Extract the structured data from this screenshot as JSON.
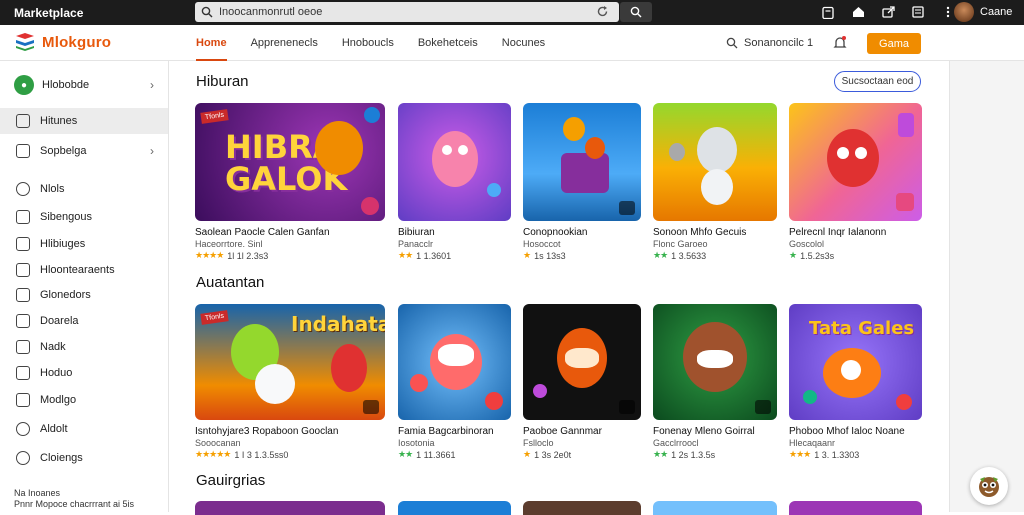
{
  "topbar": {
    "app_title": "Marketplace",
    "search_value": "Inoocanmonrutl oeoe",
    "user_name": "Caane"
  },
  "navbar": {
    "logo_text": "Mlokguro",
    "tabs": [
      "Home",
      "Apprenenecls",
      "Hnoboucls",
      "Bokehetceis",
      "Nocunes"
    ],
    "account_text": "Sonanoncilc 1",
    "cta_label": "Gama"
  },
  "sidebar": {
    "profile_label": "Hlobobde",
    "items": [
      "Hitunes",
      "Sopbelga",
      "Nlols",
      "Sibengous",
      "Hlibiuges",
      "Hloontearaents",
      "Glonedors",
      "Doarela",
      "Nadk",
      "Hoduo",
      "Modlgo",
      "Aldolt",
      "Cloiengs"
    ],
    "footer_line1": "Na   Inoanes",
    "footer_line2": "Pnnr  Mopoce chacrrrant ai 5is"
  },
  "sections": [
    {
      "title": "Hiburan",
      "see_all": "Sucsoctaan eod",
      "cards": [
        {
          "name": "Saolean Paocle Calen Ganfan",
          "dev": "Haceorrtore. Sinl",
          "rating": "1l 1l 2.3s3",
          "stars": "★★★★",
          "art": "HIBRA GALOK",
          "badge": "Tfonls"
        },
        {
          "name": "Bibiuran",
          "dev": "Panacclr",
          "rating": "1 1.3601",
          "stars": "★★",
          "art": "",
          "badge": ""
        },
        {
          "name": "Conopnookian",
          "dev": "Hosoccot",
          "rating": "1s 13s3",
          "stars": "★",
          "art": "",
          "badge": ""
        },
        {
          "name": "Sonoon Mhfo Gecuis",
          "dev": "Flonc Garoeo",
          "rating": "1 3.5633",
          "stars": "★★",
          "art": "",
          "badge": ""
        },
        {
          "name": "Pelrecnl Inqr Ialanonn",
          "dev": "Goscolol",
          "rating": "1.5.2s3s",
          "stars": "★",
          "art": "",
          "badge": ""
        }
      ]
    },
    {
      "title": "Auatantan",
      "see_all": "",
      "cards": [
        {
          "name": "Isntohyjare3 Ropaboon Gooclan",
          "dev": "Sooocanan",
          "rating": "1 I 3 1.3.5ss0",
          "stars": "★★★★★",
          "art": "Indahatan",
          "badge": "Tfonls"
        },
        {
          "name": "Famia Bagcarbinoran",
          "dev": "Iosotonia",
          "rating": "1 11.3661",
          "stars": "★★",
          "art": "",
          "badge": ""
        },
        {
          "name": "Paoboe Gannmar",
          "dev": "Fslloclo",
          "rating": "1 3s 2e0t",
          "stars": "★",
          "art": "",
          "badge": ""
        },
        {
          "name": "Fonenay Mleno Goirral",
          "dev": "Gacclrroocl",
          "rating": "1 2s 1.3.5s",
          "stars": "★★",
          "art": "",
          "badge": ""
        },
        {
          "name": "Phoboo Mhof Ialoc Noane",
          "dev": "Hlecaqaanr",
          "rating": "1 3. 1.3303",
          "stars": "★★★",
          "art": "Tata Gales",
          "badge": ""
        }
      ]
    },
    {
      "title": "Gauirgrias",
      "see_all": "",
      "cards": []
    }
  ],
  "colors": {
    "accent": "#d9480f",
    "cta": "#f08c00",
    "topbar": "#1c1c1c"
  }
}
